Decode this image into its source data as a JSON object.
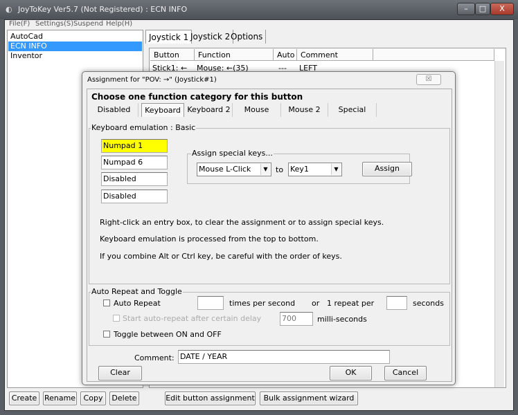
{
  "window": {
    "title": "JoyToKey Ver5.7 (Not Registered) : ECN INFO",
    "minimize": "–",
    "maximize": "□",
    "close": "X"
  },
  "menu": [
    "File(F)",
    "Settings(S)",
    "Suspend",
    "Help(H)"
  ],
  "profiles": {
    "items": [
      "AutoCad",
      "ECN INFO",
      "Inventor"
    ],
    "selected": "ECN INFO"
  },
  "main_tabs": [
    "Joystick 1",
    "Joystick 2",
    "Options"
  ],
  "table": {
    "columns": [
      "Button",
      "Function",
      "Auto",
      "Comment"
    ],
    "rows": [
      [
        "Stick1: ←",
        "Mouse: ←(35)",
        "---",
        "LEFT"
      ]
    ]
  },
  "bottom_buttons": {
    "create": "Create",
    "rename": "Rename",
    "copy": "Copy",
    "delete": "Delete",
    "edit": "Edit button assignment",
    "bulk": "Bulk assignment wizard"
  },
  "dialog": {
    "title": "Assignment for \"POV: →\" (Joystick#1)",
    "close": "☒",
    "heading": "Choose one function category for this button",
    "tabs": [
      "Disabled",
      "Keyboard",
      "Keyboard 2",
      "Mouse",
      "Mouse 2",
      "Special"
    ],
    "selected_tab": "Keyboard",
    "kbd_group": "Keyboard emulation : Basic",
    "keys": [
      "Numpad 1",
      "Numpad 6",
      "Disabled",
      "Disabled"
    ],
    "highlight_color": "#ffff00",
    "special_group": "Assign special keys...",
    "special_key": "Mouse L-Click",
    "to": "to",
    "target_key": "Key1",
    "assign": "Assign",
    "help": [
      "Right-click an entry box, to clear the assignment or to assign special keys.",
      "Keyboard emulation is processed from the top to bottom.",
      "If you combine Alt or Ctrl key, be careful with the order of keys."
    ],
    "repeat_group": "Auto Repeat and Toggle",
    "auto_repeat": "Auto Repeat",
    "times_per_second": "times per second",
    "or": "or",
    "one_repeat_per": "1 repeat per",
    "seconds": "seconds",
    "delay_label": "Start auto-repeat after certain delay",
    "delay_value": "700",
    "ms": "milli-seconds",
    "toggle": "Toggle between ON and OFF",
    "comment_label": "Comment:",
    "comment": "DATE / YEAR",
    "clear": "Clear",
    "ok": "OK",
    "cancel": "Cancel"
  }
}
